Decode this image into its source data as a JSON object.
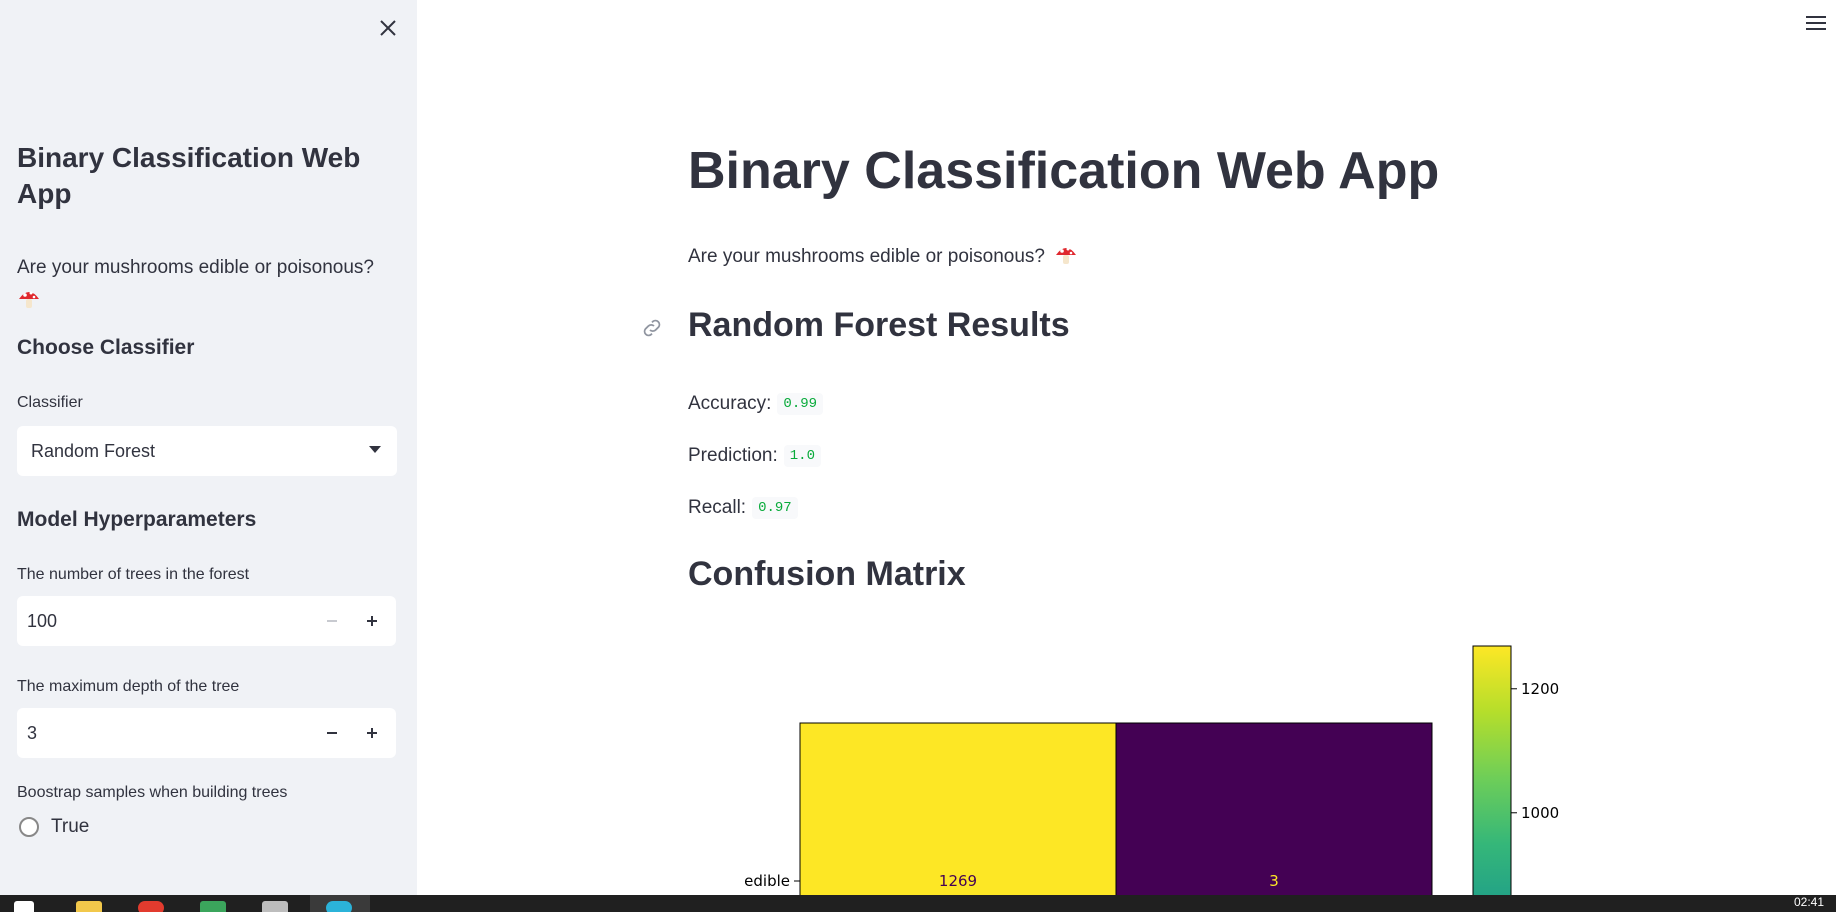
{
  "sidebar": {
    "title": "Binary Classification Web App",
    "subtitle": "Are your mushrooms edible or poisonous?",
    "choose_heading": "Choose Classifier",
    "classifier_label": "Classifier",
    "classifier_value": "Random Forest",
    "hyper_heading": "Model Hyperparameters",
    "n_trees_label": "The number of trees in the forest",
    "n_trees_value": "100",
    "max_depth_label": "The maximum depth of the tree",
    "max_depth_value": "3",
    "bootstrap_label": "Boostrap samples when building trees",
    "bootstrap_option_true": "True"
  },
  "main": {
    "title": "Binary Classification Web App",
    "subtitle": "Are your mushrooms edible or poisonous?",
    "results_heading": "Random Forest Results",
    "accuracy_label": "Accuracy:",
    "accuracy_value": "0.99",
    "precision_label": "Prediction:",
    "precision_value": "1.0",
    "recall_label": "Recall:",
    "recall_value": "0.97",
    "cm_heading": "Confusion Matrix"
  },
  "chart_data": {
    "type": "heatmap",
    "row_labels": [
      "edible"
    ],
    "values": [
      [
        1269,
        3
      ]
    ],
    "cell_colors": [
      [
        "#FDE725",
        "#440154"
      ]
    ],
    "cell_text_colors": [
      [
        "#440154",
        "#FDE725"
      ]
    ],
    "colorbar_ticks": [
      1200,
      1000
    ],
    "colorbar_range": [
      0,
      1269
    ],
    "colormap": "viridis"
  },
  "taskbar": {
    "clock": "02:41"
  },
  "colors": {
    "sidebar_bg": "#F0F2F6",
    "text": "#31333F",
    "code_green": "#09AB3B"
  }
}
